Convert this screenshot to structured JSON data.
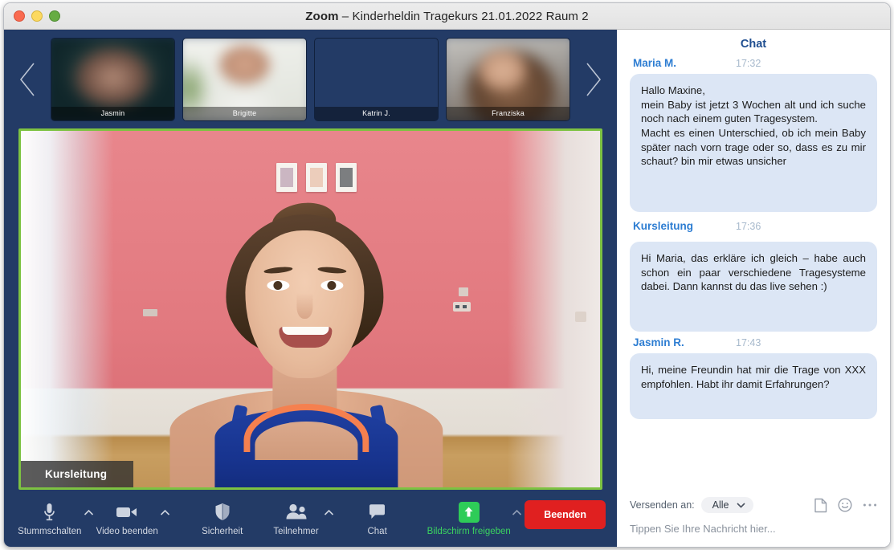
{
  "window": {
    "title_app": "Zoom",
    "title_sep": " – ",
    "title_meeting": "Kinderheldin Tragekurs 21.01.2022 Raum 2",
    "traffic_lights": {
      "close": "close-button",
      "minimize": "minimize-button",
      "maximize": "maximize-button"
    },
    "colors": {
      "titlebar": "#ececec",
      "meeting_bg": "#233b66",
      "active_speaker_border": "#7dc242",
      "leave_button": "#e02020",
      "share_accent": "#3bd45f",
      "chat_bubble": "#dce6f5",
      "sender_name": "#2d7dd2",
      "chat_header": "#1f4e90"
    }
  },
  "filmstrip": {
    "prev_arrow": "chevron-left-icon",
    "next_arrow": "chevron-right-icon",
    "thumbnails": [
      {
        "name": "Jasmin"
      },
      {
        "name": "Brigitte"
      },
      {
        "name": "Katrin J."
      },
      {
        "name": "Franziska"
      }
    ]
  },
  "speaker": {
    "name": "Kursleitung"
  },
  "toolbar": {
    "items": [
      {
        "label": "Stummschalten",
        "icon": "microphone-icon",
        "caret": true,
        "accent": false
      },
      {
        "label": "Video beenden",
        "icon": "video-camera-icon",
        "caret": true,
        "accent": false
      },
      {
        "label": "Sicherheit",
        "icon": "shield-icon",
        "caret": false,
        "accent": false
      },
      {
        "label": "Teilnehmer",
        "icon": "participants-icon",
        "caret": true,
        "accent": false
      },
      {
        "label": "Chat",
        "icon": "chat-bubble-icon",
        "caret": false,
        "accent": false
      },
      {
        "label": "Bildschirm freigeben",
        "icon": "share-screen-icon",
        "caret": true,
        "accent": true
      }
    ],
    "leave_label": "Beenden"
  },
  "chat": {
    "header": "Chat",
    "messages": [
      {
        "sender": "Maria M.",
        "time": "17:32",
        "text": "Hallo Maxine,\nmein Baby ist jetzt 3 Wochen alt und ich suche noch nach einem guten Tragesystem.\nMacht es einen Unterschied, ob ich mein Baby später nach vorn trage oder so, dass es zu mir schaut? bin mir etwas unsicher"
      },
      {
        "sender": "Kursleitung",
        "time": "17:36",
        "text": "Hi Maria, das erkläre ich gleich – habe auch schon ein paar verschiedene Tragesysteme dabei. Dann kannst du das live sehen :)"
      },
      {
        "sender": "Jasmin R.",
        "time": "17:43",
        "text": "Hi, meine Freundin hat mir die Trage von XXX empfohlen. Habt ihr damit Erfahrungen?"
      }
    ],
    "footer": {
      "send_to_label": "Versenden an:",
      "send_to_value": "Alle",
      "dropdown_icon": "chevron-down-icon",
      "file_icon": "file-icon",
      "emoji_icon": "emoji-icon",
      "more_icon": "ellipsis-icon",
      "input_placeholder": "Tippen Sie Ihre Nachricht hier..."
    }
  }
}
